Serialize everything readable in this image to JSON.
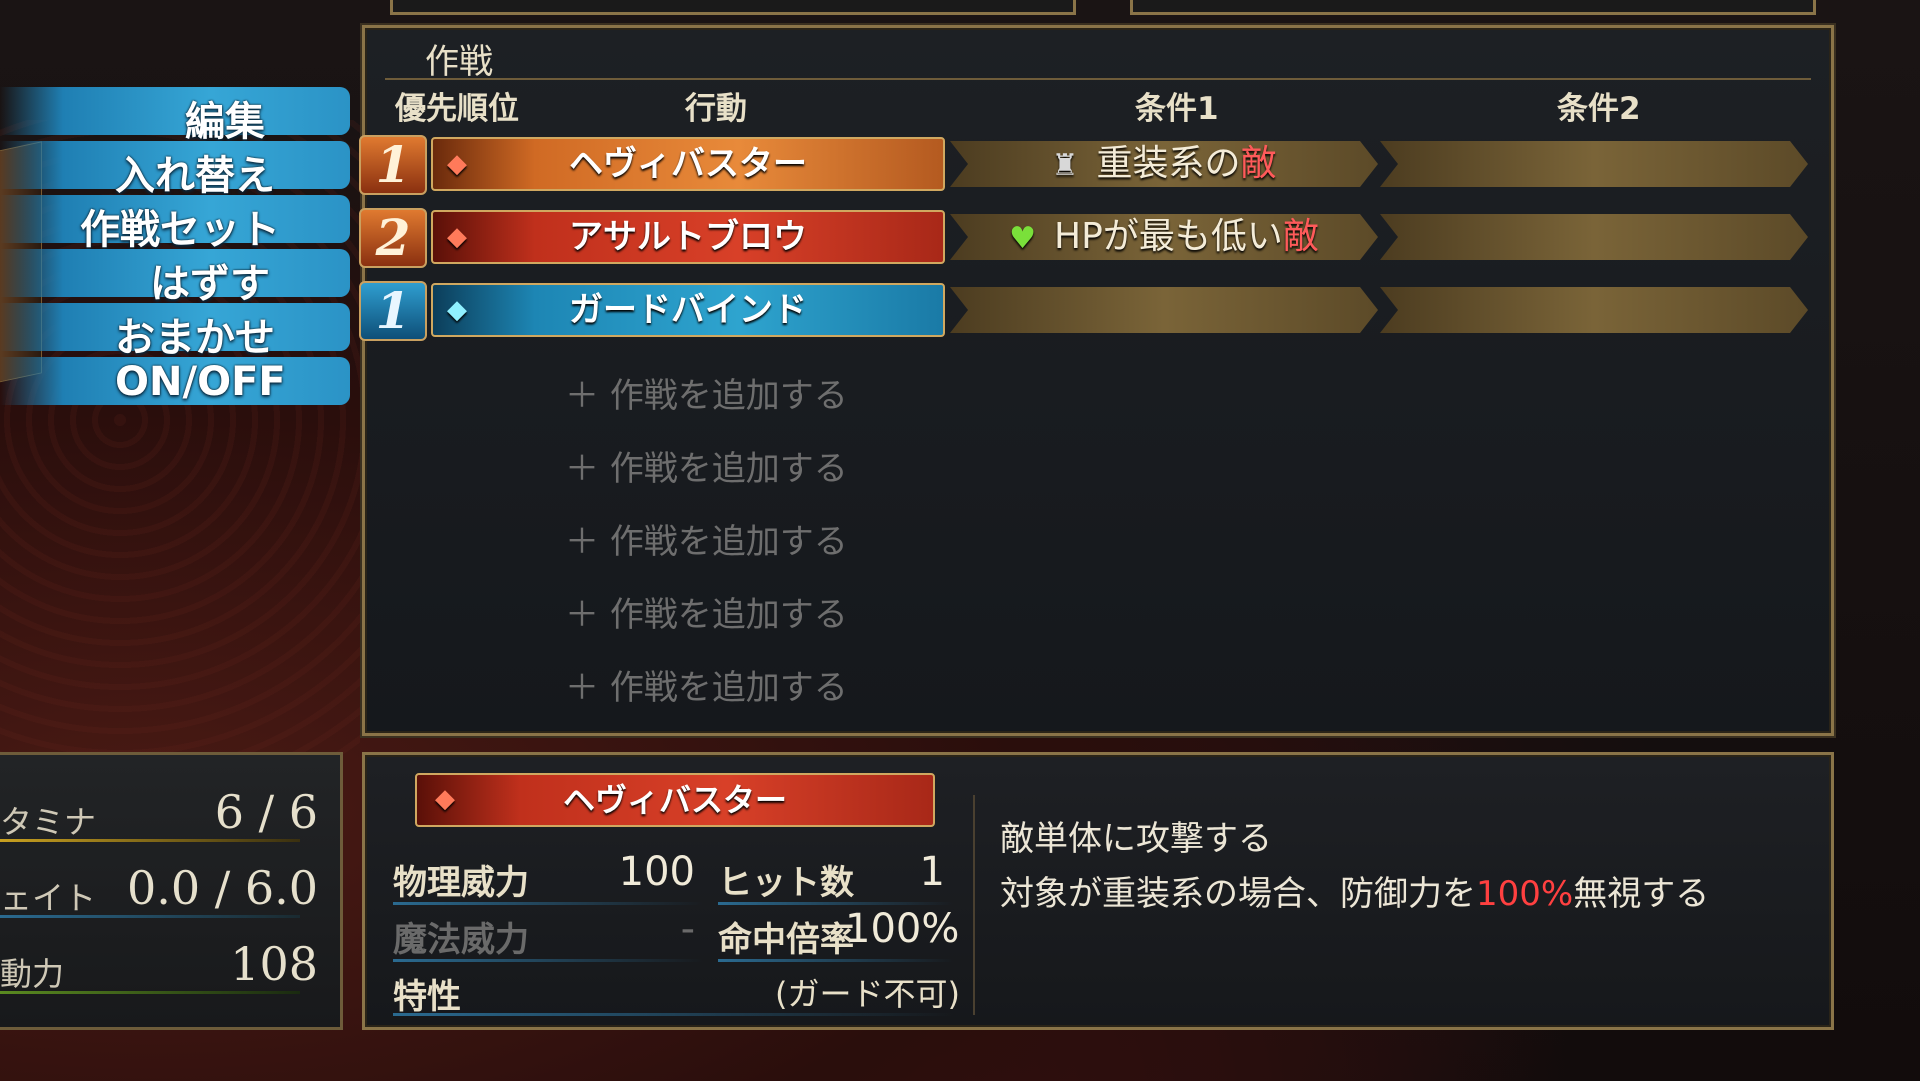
{
  "menu": {
    "items": [
      "編集",
      "入れ替え",
      "作戦セット",
      "はずす",
      "おまかせ",
      "ON/OFF"
    ]
  },
  "tactics": {
    "title": "作戦",
    "headers": {
      "priority": "優先順位",
      "action": "行動",
      "cond1": "条件1",
      "cond2": "条件2"
    },
    "rows": [
      {
        "priority": "1",
        "action": "ヘヴィバスター",
        "cond1_pre": "重装系の",
        "cond1_enemy": "敵"
      },
      {
        "priority": "2",
        "action": "アサルトブロウ",
        "cond1_pre": "HPが最も低い",
        "cond1_enemy": "敵"
      },
      {
        "priority": "1",
        "action": "ガードバインド"
      }
    ],
    "add_label": "作戦を追加する"
  },
  "detail": {
    "name": "ヘヴィバスター",
    "phys_label": "物理威力",
    "phys_val": "100",
    "hit_label": "ヒット数",
    "hit_val": "1",
    "magic_label": "魔法威力",
    "magic_val": "-",
    "acc_label": "命中倍率",
    "acc_val": "100%",
    "trait_label": "特性",
    "trait_val": "(ガード不可)",
    "desc1": "敵単体に攻撃する",
    "desc2_pre": "対象が重装系の場合、防御力を",
    "desc2_red": "100%",
    "desc2_post": "無視する"
  },
  "status": {
    "stamina_label": "タミナ",
    "stamina_val": "6 / 6",
    "weight_label": "ェイト",
    "weight_val": "0.0 / 6.0",
    "power_label": "動力",
    "power_val": "108"
  },
  "colors": {
    "frame": "#8a7448",
    "enemy": "#ff5a5a",
    "menu": "#36a6d6"
  }
}
